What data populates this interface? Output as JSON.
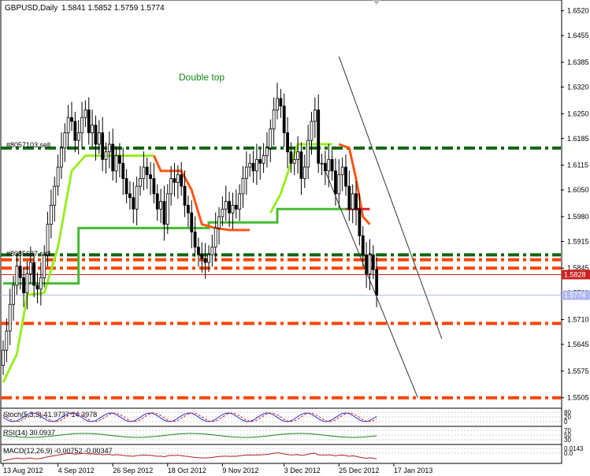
{
  "header": {
    "symbol": "GBPUSD,Daily",
    "ohlc": "1.5841 1.5852 1.5759 1.5774"
  },
  "annotation": "Double top",
  "order_labels": [
    "#8057103 sell",
    "#8085687 sell"
  ],
  "colors": {
    "candle": "#000000",
    "trail_bright": "#99ee22",
    "trail_green": "#44bb33",
    "trail_orange": "#ff5511",
    "trail_red": "#dd2233",
    "level_green": "#116611",
    "level_orange": "#ff4400",
    "level_red": "#cc2222",
    "text_green": "#118811",
    "bid_line": "#b0b8ee",
    "stoch_main": "#2233dd",
    "stoch_signal": "#dd2222",
    "rsi": "#118811",
    "macd": "#aa2222"
  },
  "chart_data": {
    "type": "candlestick",
    "symbol": "GBPUSD",
    "timeframe": "Daily",
    "y_axis": {
      "min": 1.549,
      "max": 1.654,
      "ticks": [
        "1.6520",
        "1.6455",
        "1.6385",
        "1.6320",
        "1.6250",
        "1.6185",
        "1.6115",
        "1.6050",
        "1.5980",
        "1.5915",
        "1.5845",
        "1.5780",
        "1.5710",
        "1.5645",
        "1.5575",
        "1.5505"
      ]
    },
    "x_axis": {
      "ticks": [
        {
          "label": "13 Aug 2012",
          "bar": 0
        },
        {
          "label": "4 Sep 2012",
          "bar": 16
        },
        {
          "label": "26 Sep 2012",
          "bar": 32
        },
        {
          "label": "18 Oct 2012",
          "bar": 48
        },
        {
          "label": "9 Nov 2012",
          "bar": 64
        },
        {
          "label": "3 Dec 2012",
          "bar": 82
        },
        {
          "label": "25 Dec 2012",
          "bar": 98
        },
        {
          "label": "17 Jan 2013",
          "bar": 114
        }
      ]
    },
    "close_series": [
      1.563,
      1.568,
      1.575,
      1.58,
      1.585,
      1.582,
      1.578,
      1.583,
      1.586,
      1.58,
      1.579,
      1.582,
      1.588,
      1.596,
      1.601,
      1.606,
      1.611,
      1.616,
      1.62,
      1.624,
      1.623,
      1.618,
      1.62,
      1.624,
      1.626,
      1.62,
      1.622,
      1.617,
      1.62,
      1.613,
      1.615,
      1.617,
      1.61,
      1.614,
      1.612,
      1.608,
      1.604,
      1.603,
      1.6,
      1.606,
      1.608,
      1.611,
      1.609,
      1.608,
      1.604,
      1.6,
      1.602,
      1.596,
      1.604,
      1.608,
      1.607,
      1.609,
      1.606,
      1.601,
      1.599,
      1.594,
      1.59,
      1.588,
      1.587,
      1.586,
      1.588,
      1.59,
      1.595,
      1.598,
      1.6,
      1.602,
      1.599,
      1.601,
      1.6,
      1.604,
      1.608,
      1.611,
      1.612,
      1.61,
      1.613,
      1.612,
      1.614,
      1.616,
      1.621,
      1.626,
      1.629,
      1.627,
      1.62,
      1.615,
      1.612,
      1.613,
      1.615,
      1.608,
      1.611,
      1.618,
      1.623,
      1.626,
      1.612,
      1.612,
      1.61,
      1.613,
      1.61,
      1.604,
      1.609,
      1.611,
      1.606,
      1.6,
      1.604,
      1.6,
      1.593,
      1.588,
      1.583,
      1.588,
      1.5841,
      1.5774
    ],
    "horizontal_levels": [
      {
        "price": 1.616,
        "color": "#116611",
        "style": "dashdot",
        "label": "#8057103 sell"
      },
      {
        "price": 1.588,
        "color": "#116611",
        "style": "dashdot",
        "label": "#8085687 sell"
      },
      {
        "price": 1.5867,
        "color": "#ff4400",
        "style": "dashdot"
      },
      {
        "price": 1.5845,
        "color": "#ff4400",
        "style": "dashdot"
      },
      {
        "price": 1.5828,
        "color": "#cc2222",
        "style": "solid",
        "label": "1.5828"
      },
      {
        "price": 1.5774,
        "color": "#b0b8ee",
        "style": "solid",
        "label": "1.5774"
      },
      {
        "price": 1.57,
        "color": "#ff4400",
        "style": "dashdot"
      },
      {
        "price": 1.5505,
        "color": "#ff4400",
        "style": "dashdot"
      }
    ],
    "trendlines": [
      {
        "from": {
          "bar": 98,
          "price": 1.64
        },
        "to": {
          "bar": 128,
          "price": 1.566
        }
      },
      {
        "from": {
          "bar": 94,
          "price": 1.61
        },
        "to": {
          "bar": 121,
          "price": 1.5505
        }
      }
    ],
    "annotations": [
      {
        "text": "Double top",
        "bar": 59,
        "price": 1.644
      }
    ],
    "subwindows": [
      {
        "name": "Stoch(5,3,3)",
        "values": "41.9737 14.3978",
        "levels": [
          "80",
          "20",
          "0"
        ]
      },
      {
        "name": "RSI(14)",
        "values": "30.0937",
        "levels": [
          "70",
          "50",
          "30"
        ]
      },
      {
        "name": "MACD(12,26,9)",
        "values": "-0.00752 -0.00347",
        "levels": [
          "0.0143",
          "0.0"
        ]
      }
    ]
  }
}
